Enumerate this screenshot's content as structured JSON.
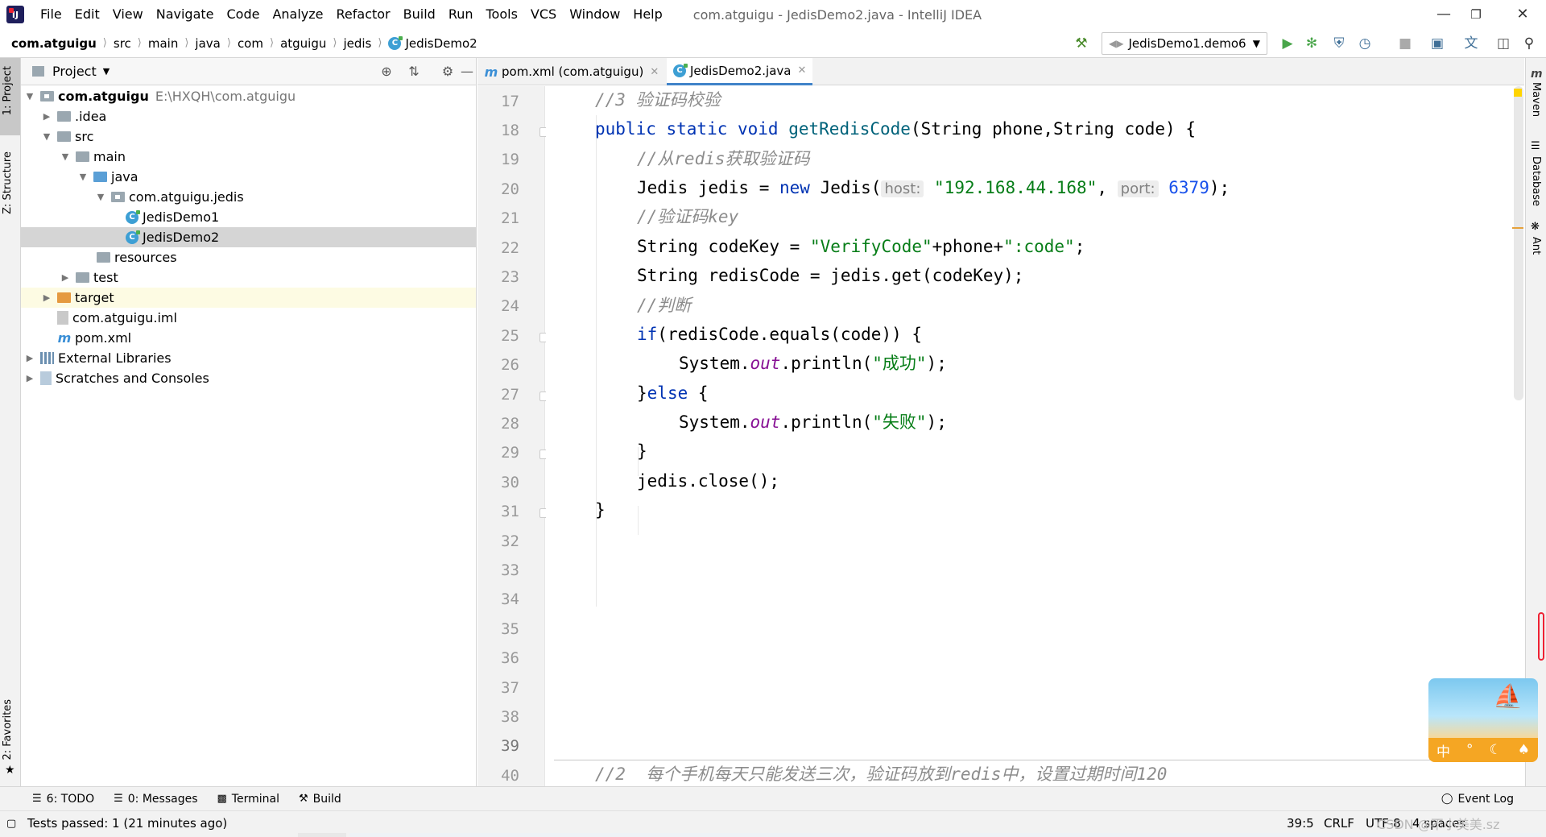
{
  "window": {
    "title": "com.atguigu - JedisDemo2.java - IntelliJ IDEA",
    "menu": [
      "File",
      "Edit",
      "View",
      "Navigate",
      "Code",
      "Analyze",
      "Refactor",
      "Build",
      "Run",
      "Tools",
      "VCS",
      "Window",
      "Help"
    ]
  },
  "breadcrumb": [
    "com.atguigu",
    "src",
    "main",
    "java",
    "com",
    "atguigu",
    "jedis",
    "JedisDemo2"
  ],
  "run_config": "JedisDemo1.demo6",
  "left_stripe": {
    "project": "1: Project",
    "structure": "Z: Structure",
    "favorites": "2: Favorites"
  },
  "right_stripe": {
    "maven": "Maven",
    "database": "Database",
    "ant": "Ant"
  },
  "project_panel": {
    "title": "Project",
    "tree": [
      {
        "label": "com.atguigu",
        "path": "E:\\HXQH\\com.atguigu"
      },
      {
        "label": ".idea"
      },
      {
        "label": "src"
      },
      {
        "label": "main"
      },
      {
        "label": "java"
      },
      {
        "label": "com.atguigu.jedis"
      },
      {
        "label": "JedisDemo1"
      },
      {
        "label": "JedisDemo2"
      },
      {
        "label": "resources"
      },
      {
        "label": "test"
      },
      {
        "label": "target"
      },
      {
        "label": "com.atguigu.iml"
      },
      {
        "label": "pom.xml"
      },
      {
        "label": "External Libraries"
      },
      {
        "label": "Scratches and Consoles"
      }
    ]
  },
  "editor": {
    "tabs": [
      {
        "label": "pom.xml (com.atguigu)",
        "active": false
      },
      {
        "label": "JedisDemo2.java",
        "active": true
      }
    ],
    "line_numbers": [
      "17",
      "18",
      "19",
      "20",
      "21",
      "22",
      "23",
      "24",
      "25",
      "26",
      "27",
      "28",
      "29",
      "30",
      "31",
      "32",
      "33",
      "34",
      "35",
      "36",
      "37",
      "38",
      "39",
      "40"
    ],
    "code": {
      "l17": "//3 验证码校验",
      "l18_kw": "public static void",
      "l18_name": "getRedisCode",
      "l18_params": "(String phone,String code) {",
      "l19": "//从redis获取验证码",
      "l20_a": "Jedis jedis = ",
      "l20_new": "new",
      "l20_b": " Jedis(",
      "l20_hint_host": "host:",
      "l20_host": "\"192.168.44.168\"",
      "l20_hint_port": "port:",
      "l20_port": "6379",
      "l20_end": ");",
      "l21": "//验证码key",
      "l22_a": "String codeKey = ",
      "l22_s1": "\"VerifyCode\"",
      "l22_b": "+phone+",
      "l22_s2": "\":code\"",
      "l22_end": ";",
      "l23": "String redisCode = jedis.get(codeKey);",
      "l24": "//判断",
      "l25_kw": "if",
      "l25_rest": "(redisCode.equals(code)) {",
      "l26_a": "System.",
      "l26_out": "out",
      "l26_b": ".println(",
      "l26_str": "\"成功\"",
      "l26_end": ");",
      "l27_a": "}",
      "l27_kw": "else",
      "l27_b": " {",
      "l28_a": "System.",
      "l28_out": "out",
      "l28_b": ".println(",
      "l28_str": "\"失败\"",
      "l28_end": ");",
      "l29": "}",
      "l30": "jedis.close();",
      "l31": "}",
      "l40": "//2  每个手机每天只能发送三次，验证码放到redis中，设置过期时间120"
    }
  },
  "bottom_tools": [
    "6: TODO",
    "0: Messages",
    "Terminal",
    "Build",
    "Event Log"
  ],
  "status": {
    "message": "Tests passed: 1 (21 minutes ago)",
    "position": "39:5",
    "line_sep": "CRLF",
    "encoding": "UTF-8",
    "indent": "4 spaces",
    "watermark": "CSDN @不小美美.sz"
  },
  "widget": {
    "chars": [
      "中",
      "°",
      "☾",
      "♠"
    ]
  },
  "colors": {
    "keyword": "#0033b3",
    "string": "#067d17",
    "comment": "#8c8c8c",
    "number": "#1750eb",
    "accent": "#4083c9"
  }
}
